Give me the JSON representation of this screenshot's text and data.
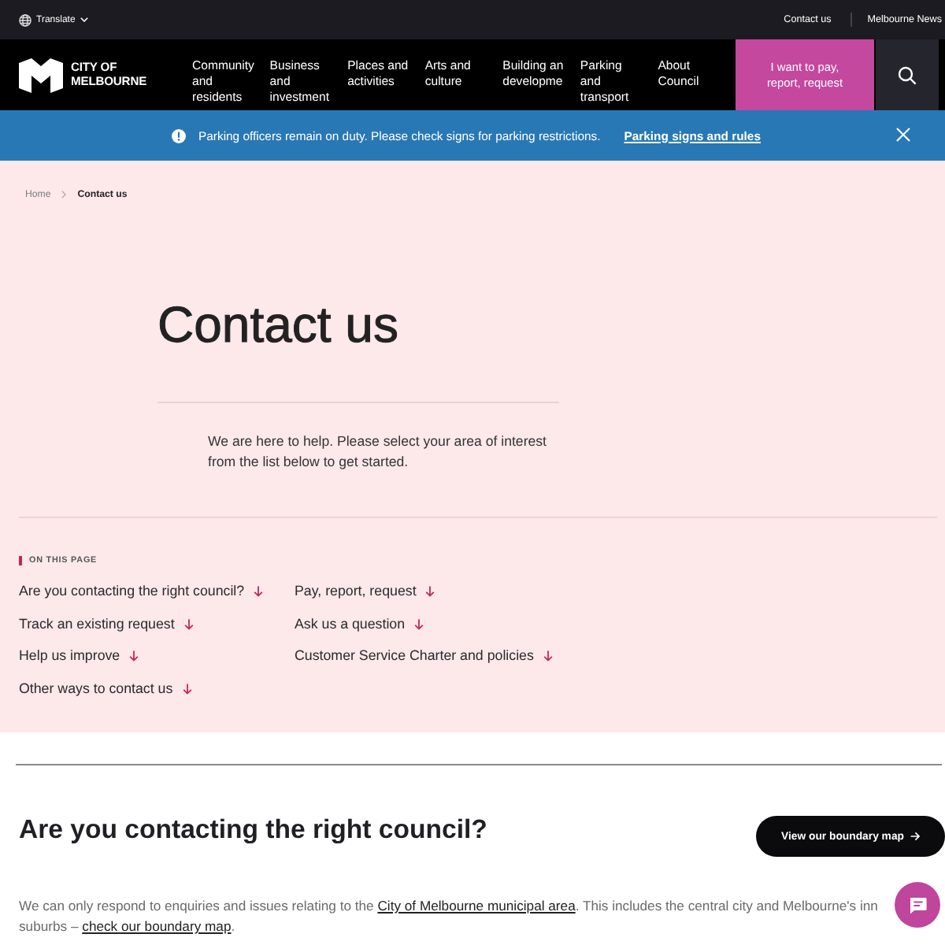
{
  "top_bar": {
    "translate": "Translate",
    "links": [
      "Contact us",
      "Melbourne News"
    ]
  },
  "header": {
    "logo": [
      "CITY OF",
      "MELBOURNE"
    ],
    "nav": [
      {
        "lines": [
          "Community",
          "and",
          "residents"
        ]
      },
      {
        "lines": [
          "Business",
          "and",
          "investment"
        ]
      },
      {
        "lines": [
          "Places and",
          "activities"
        ]
      },
      {
        "lines": [
          "Arts and",
          "culture"
        ]
      },
      {
        "lines": [
          "Building an",
          "developme"
        ]
      },
      {
        "lines": [
          "Parking",
          "and",
          "transport"
        ]
      },
      {
        "lines": [
          "About",
          "Council"
        ]
      }
    ],
    "cta": "I want to pay, report, request"
  },
  "alert": {
    "message": "Parking officers remain on duty. Please check signs for parking restrictions.",
    "link": "Parking signs and rules"
  },
  "breadcrumb": [
    {
      "label": "Home",
      "current": false
    },
    {
      "label": "Contact us",
      "current": true
    }
  ],
  "hero": {
    "title": "Contact us",
    "intro": "We are here to help. Please select your area of interest from the list below to get started."
  },
  "on_this_page": {
    "heading": "ON THIS PAGE",
    "links": [
      "Are you contacting the right council?",
      "Pay, report, request",
      "Track an existing request",
      "Ask us a question",
      "Help us improve",
      "Customer Service Charter and policies",
      "Other ways to contact us"
    ]
  },
  "section": {
    "title": "Are you contacting the right council?",
    "button": "View our boundary map",
    "paragraph": [
      [
        {
          "kind": "text",
          "text": "We can only respond to enquiries and issues relating to the "
        },
        {
          "kind": "link",
          "text": "City of Melbourne municipal area"
        },
        {
          "kind": "text",
          "text": ". This includes the central city and Melbourne's inn"
        }
      ],
      [
        {
          "kind": "text",
          "text": "suburbs – "
        },
        {
          "kind": "link",
          "text": "check our boundary map"
        },
        {
          "kind": "text",
          "text": "."
        }
      ]
    ]
  }
}
